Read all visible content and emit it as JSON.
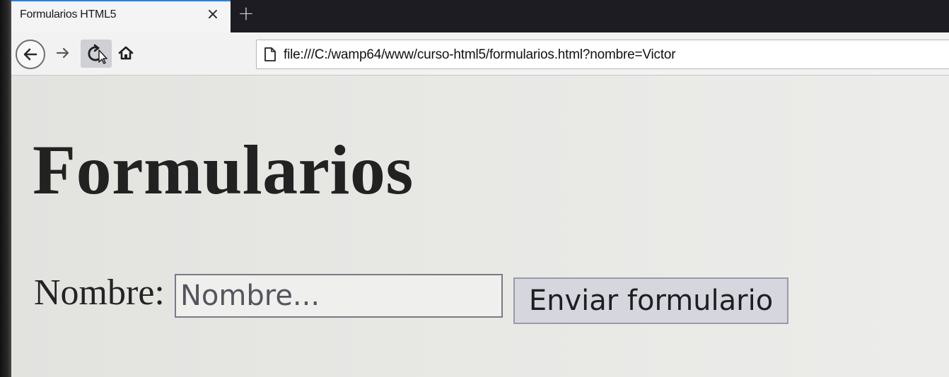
{
  "browser": {
    "tab": {
      "title": "Formularios HTML5",
      "close_glyph": "×"
    },
    "new_tab_glyph": "+",
    "toolbar": {
      "back_icon": "back-arrow-icon",
      "forward_icon": "forward-arrow-icon",
      "reload_icon": "reload-icon",
      "home_icon": "home-icon"
    },
    "address": {
      "icon": "page-icon",
      "url": "file:///C:/wamp64/www/curso-html5/formularios.html?nombre=Victor"
    },
    "colors": {
      "tabbar": "#1c1c22",
      "tab_accent": "#2b7fe0",
      "page_background": "#e6e6e3"
    }
  },
  "page": {
    "heading": "Formularios",
    "form": {
      "label": "Nombre:",
      "input": {
        "value": "",
        "placeholder": "Nombre..."
      },
      "submit_label": "Enviar formulario"
    }
  }
}
